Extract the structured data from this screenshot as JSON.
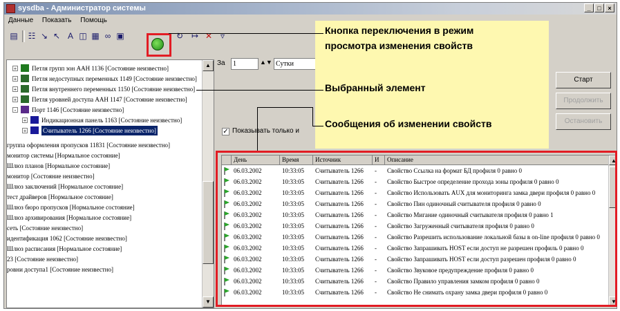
{
  "window": {
    "title": "sysdba - Администратор системы",
    "controls": [
      "_",
      "□",
      "×"
    ]
  },
  "menu": [
    "Данные",
    "Показать",
    "Помощь"
  ],
  "toolbar_icons": [
    "save-icon",
    "diagram-icon",
    "arrow-split-icon",
    "cursor-icon",
    "text-icon",
    "panel-icon",
    "grid-icon",
    "chain-icon",
    "monitor-icon",
    "refresh-icon",
    "branch-icon",
    "cross-branch-icon",
    "filter-icon"
  ],
  "tree": {
    "items": [
      {
        "label": "Петля групп зон AAH 1136 [Состояние неизвестно]",
        "exp": "+",
        "color": "#1f7a1f"
      },
      {
        "label": "Петля недоступных переменных 1149 [Состояние неизвестно]",
        "exp": "+",
        "color": "#2a6a2a"
      },
      {
        "label": "Петля внутреннего переменных 1150 [Состояние неизвестно]",
        "exp": "+",
        "color": "#2a6a2a"
      },
      {
        "label": "Петля уровней доступа AAH 1147 [Состояние неизвестно]",
        "exp": "+",
        "color": "#2a6a2a"
      },
      {
        "label": "Порт 1146 [Состояние неизвестно]",
        "exp": "-",
        "color": "#5a2a8a"
      },
      {
        "label": "Индикационная панель 1163 [Состояние неизвестно]",
        "exp": "+",
        "color": "#1a1a9a"
      },
      {
        "label": "Считыватель 1266 [Состояние неизвестно]",
        "exp": "+",
        "color": "#1a1a9a",
        "selected": true
      }
    ],
    "plain_items": [
      "группа оформления пропусков 11831 [Состояние неизвестно]",
      "монитор системы [Нормальное состояние]",
      "Шлюз планов [Нормальное состояние]",
      "монитор [Состояние неизвестно]",
      "Шлюз заключений [Нормальное состояние]",
      "тест драйверов [Нормальное состояние]",
      "Шлюз бюро пропусков [Нормальное состояние]",
      "Шлюз архивирования [Нормальное состояние]",
      "сеть [Состояние неизвестно]",
      "идентификация 1062 [Состояние неизвестно]",
      "Шлюз расписания [Нормальное состояние]",
      "23 [Состояние неизвестно]",
      "ровни доступа1 [Состояние неизвестно]"
    ]
  },
  "controls": {
    "period_label": "За",
    "period_value": "1",
    "period_unit": "Сутки",
    "start": "Старт",
    "continue": "Продолжить",
    "stop": "Остановить",
    "checkbox_label": "Показывать только и"
  },
  "callouts": {
    "mode_button": "Кнопка переключения в режим просмотра изменения свойств",
    "mode_button_line1": "Кнопка переключения в режим",
    "mode_button_line2": "просмотра изменения свойств",
    "selected_element": "Выбранный элемент",
    "messages": "Сообщения об изменении свойств"
  },
  "log": {
    "columns": [
      "",
      "День",
      "Время",
      "Источник",
      "И",
      "Описание"
    ],
    "rows": [
      [
        "06.03.2002",
        "10:33:05",
        "Считыватель 1266",
        "-",
        "Свойство Ссылка на формат БД профиля 0 равно 0"
      ],
      [
        "06.03.2002",
        "10:33:05",
        "Считыватель 1266",
        "-",
        "Свойство Быстрое определение прохода зоны профиля 0 равно 0"
      ],
      [
        "06.03.2002",
        "10:33:05",
        "Считыватель 1266",
        "-",
        "Свойство Использовать AUX для мониторинга замка двери профиля 0 равно 0"
      ],
      [
        "06.03.2002",
        "10:33:05",
        "Считыватель 1266",
        "-",
        "Свойство Пин одиночный считывателя профиля 0 равно 0"
      ],
      [
        "06.03.2002",
        "10:33:05",
        "Считыватель 1266",
        "-",
        "Свойство Мигание одиночный считывателя профиля 0 равно 1"
      ],
      [
        "06.03.2002",
        "10:33:05",
        "Считыватель 1266",
        "-",
        "Свойство Загруженный считывателя профиля 0 равно 0"
      ],
      [
        "06.03.2002",
        "10:33:05",
        "Считыватель 1266",
        "-",
        "Свойство Разрешить использование локальной базы в on-line профиля 0 равно 0"
      ],
      [
        "06.03.2002",
        "10:33:05",
        "Считыватель 1266",
        "-",
        "Свойство Запрашивать HOST если доступ не разрешен профиль 0 равно 0"
      ],
      [
        "06.03.2002",
        "10:33:05",
        "Считыватель 1266",
        "-",
        "Свойство Запрашивать HOST если доступ разрешен профиля 0 равно 0"
      ],
      [
        "06.03.2002",
        "10:33:05",
        "Считыватель 1266",
        "-",
        "Свойство Звуковое предупреждение профиля 0 равно 0"
      ],
      [
        "06.03.2002",
        "10:33:05",
        "Считыватель 1266",
        "-",
        "Свойство Правило управления замком профиля 0 равно 0"
      ],
      [
        "06.03.2002",
        "10:33:05",
        "Считыватель 1266",
        "-",
        "Свойство Не снимать охрану замка двери профиля 0 равно 0"
      ]
    ]
  }
}
